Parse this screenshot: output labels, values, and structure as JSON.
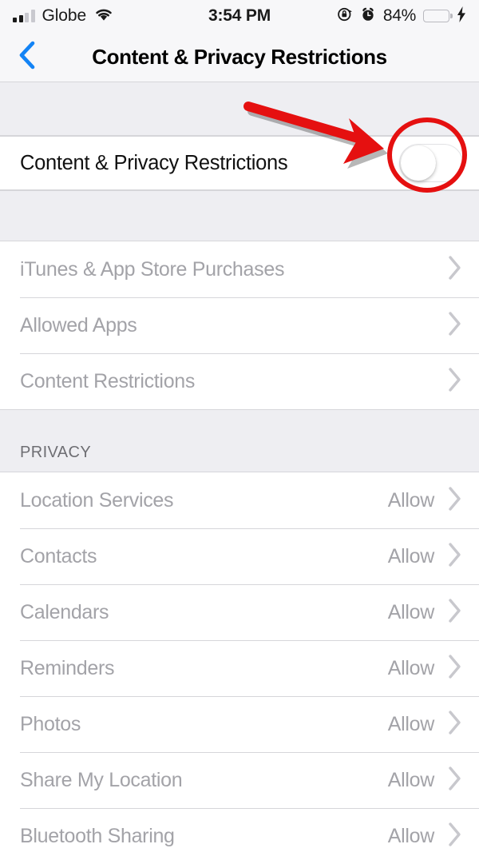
{
  "status_bar": {
    "carrier": "Globe",
    "time": "3:54 PM",
    "battery_percent": "84%",
    "signal_bars_filled": 2,
    "signal_bars_total": 4,
    "battery_level": 84,
    "icons": {
      "wifi": "wifi-icon",
      "rotation_lock": "rotation-lock-icon",
      "alarm": "alarm-clock-icon",
      "charging": "lightning-bolt-icon"
    },
    "colors": {
      "battery_green": "#4cd662",
      "bar_on": "#1a1a1a",
      "bar_off": "#c9c9cf"
    }
  },
  "nav_bar": {
    "back_label": "Back",
    "title": "Content & Privacy Restrictions",
    "accent": "#1383f5"
  },
  "main_toggle": {
    "label": "Content & Privacy Restrictions",
    "state": "off",
    "state_label": "Off"
  },
  "restrictions_section": {
    "items": [
      {
        "label": "iTunes & App Store Purchases",
        "disabled": true
      },
      {
        "label": "Allowed Apps",
        "disabled": true
      },
      {
        "label": "Content Restrictions",
        "disabled": true
      }
    ]
  },
  "privacy_section": {
    "header": "PRIVACY",
    "items": [
      {
        "label": "Location Services",
        "value": "Allow"
      },
      {
        "label": "Contacts",
        "value": "Allow"
      },
      {
        "label": "Calendars",
        "value": "Allow"
      },
      {
        "label": "Reminders",
        "value": "Allow"
      },
      {
        "label": "Photos",
        "value": "Allow"
      },
      {
        "label": "Share My Location",
        "value": "Allow"
      },
      {
        "label": "Bluetooth Sharing",
        "value": "Allow"
      }
    ]
  },
  "annotations": {
    "color": "#e51010",
    "arrow": "red-arrow-pointing-to-toggle",
    "circle": "red-circle-highlight-around-toggle"
  }
}
